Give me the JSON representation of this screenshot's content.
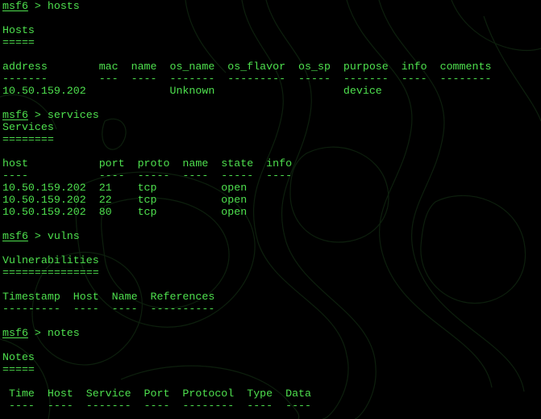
{
  "theme": {
    "background": "#000000",
    "foreground": "#4ee04e",
    "art_stroke": "#0d1f0d"
  },
  "terminal": {
    "prompt": "msf6",
    "lines": [
      {
        "type": "cmd",
        "text": " > hosts"
      },
      {
        "type": "blank",
        "text": ""
      },
      {
        "type": "text",
        "text": "Hosts"
      },
      {
        "type": "text",
        "text": "====="
      },
      {
        "type": "blank",
        "text": ""
      },
      {
        "type": "text",
        "text": "address        mac  name  os_name  os_flavor  os_sp  purpose  info  comments"
      },
      {
        "type": "text",
        "text": "-------        ---  ----  -------  ---------  -----  -------  ----  --------"
      },
      {
        "type": "text",
        "text": "10.50.159.202             Unknown                    device"
      },
      {
        "type": "blank",
        "text": ""
      },
      {
        "type": "cmd",
        "text": " > services"
      },
      {
        "type": "text",
        "text": "Services"
      },
      {
        "type": "text",
        "text": "========"
      },
      {
        "type": "blank",
        "text": ""
      },
      {
        "type": "text",
        "text": "host           port  proto  name  state  info"
      },
      {
        "type": "text",
        "text": "----           ----  -----  ----  -----  ----"
      },
      {
        "type": "text",
        "text": "10.50.159.202  21    tcp          open"
      },
      {
        "type": "text",
        "text": "10.50.159.202  22    tcp          open"
      },
      {
        "type": "text",
        "text": "10.50.159.202  80    tcp          open"
      },
      {
        "type": "blank",
        "text": ""
      },
      {
        "type": "cmd",
        "text": " > vulns"
      },
      {
        "type": "blank",
        "text": ""
      },
      {
        "type": "text",
        "text": "Vulnerabilities"
      },
      {
        "type": "text",
        "text": "==============="
      },
      {
        "type": "blank",
        "text": ""
      },
      {
        "type": "text",
        "text": "Timestamp  Host  Name  References"
      },
      {
        "type": "text",
        "text": "---------  ----  ----  ----------"
      },
      {
        "type": "blank",
        "text": ""
      },
      {
        "type": "cmd",
        "text": " > notes"
      },
      {
        "type": "blank",
        "text": ""
      },
      {
        "type": "text",
        "text": "Notes"
      },
      {
        "type": "text",
        "text": "====="
      },
      {
        "type": "blank",
        "text": ""
      },
      {
        "type": "text",
        "text": " Time  Host  Service  Port  Protocol  Type  Data"
      },
      {
        "type": "text",
        "text": " ----  ----  -------  ----  --------  ----  ----"
      }
    ]
  }
}
